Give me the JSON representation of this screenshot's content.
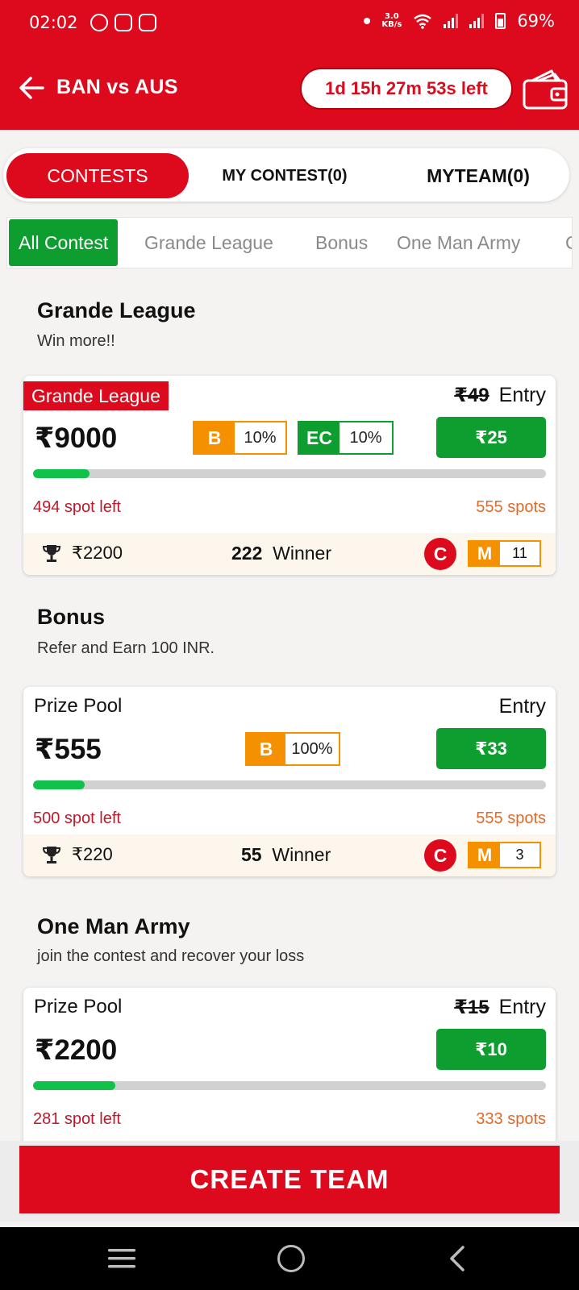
{
  "status_bar": {
    "time": "02:02",
    "speed_value": "3.0",
    "speed_unit": "KB/s",
    "battery": "69%"
  },
  "header": {
    "title": "BAN vs AUS",
    "timer": "1d 15h 27m 53s left"
  },
  "tabs": {
    "contests": "CONTESTS",
    "my_contest": "MY CONTEST(0)",
    "my_team": "MYTEAM(0)"
  },
  "filters": [
    "All Contest",
    "Grande League",
    "Bonus",
    "One Man Army",
    "C"
  ],
  "sections": [
    {
      "title": "Grande League",
      "subtitle": "Win more!!",
      "card": {
        "tag": "Grande League",
        "old_entry": "₹49",
        "entry_label": "Entry",
        "prize": "₹9000",
        "badge1_key": "B",
        "badge1_val": "10%",
        "badge2_key": "EC",
        "badge2_val": "10%",
        "fee": "₹25",
        "progress_fraction": 0.11,
        "spots_left": "494  spot left",
        "spots_total": "555 spots",
        "foot_prize": "₹2200",
        "winners_count": "222",
        "winners_label": "Winner",
        "c_label": "C",
        "m_key": "M",
        "m_val": "11"
      }
    },
    {
      "title": "Bonus",
      "subtitle": "Refer and Earn 100 INR.",
      "card": {
        "pp_label": "Prize Pool",
        "entry_label": "Entry",
        "prize": "₹555",
        "badge1_key": "B",
        "badge1_val": "100%",
        "fee": "₹33",
        "progress_fraction": 0.1,
        "spots_left": "500  spot left",
        "spots_total": "555 spots",
        "foot_prize": "₹220",
        "winners_count": "55",
        "winners_label": "Winner",
        "c_label": "C",
        "m_key": "M",
        "m_val": "3"
      }
    },
    {
      "title": "One Man Army",
      "subtitle": "join the contest and recover your loss",
      "card": {
        "pp_label": "Prize Pool",
        "old_entry": "₹15",
        "entry_label": "Entry",
        "prize": "₹2200",
        "fee": "₹10",
        "progress_fraction": 0.16,
        "spots_left": "281  spot left",
        "spots_total": "333 spots"
      }
    }
  ],
  "create_team": "CREATE TEAM",
  "colors": {
    "brand_red": "#dc0a1c",
    "green": "#0e9e30",
    "orange": "#f59000"
  }
}
